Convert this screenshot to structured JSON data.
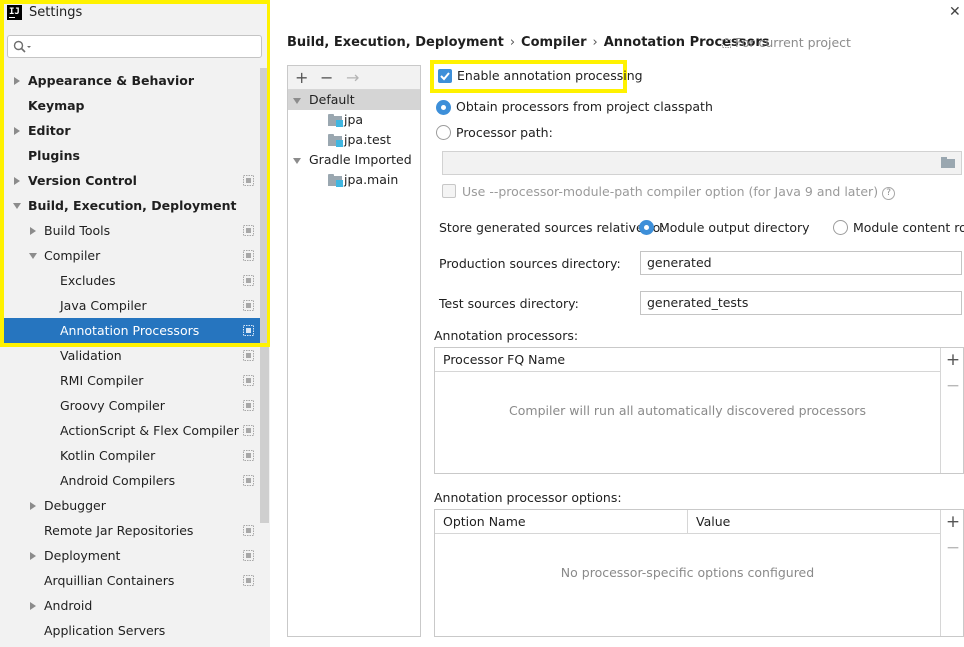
{
  "window": {
    "app_icon_text": "IJ",
    "title": "Settings",
    "close_glyph": "✕"
  },
  "search": {
    "placeholder": "",
    "icon": "search-icon"
  },
  "tree": [
    {
      "label": "Appearance & Behavior",
      "bold": true
    },
    {
      "label": "Keymap",
      "bold": true
    },
    {
      "label": "Editor",
      "bold": true
    },
    {
      "label": "Plugins",
      "bold": true
    },
    {
      "label": "Version Control",
      "bold": true
    },
    {
      "label": "Build, Execution, Deployment",
      "bold": true
    },
    {
      "label": "Build Tools"
    },
    {
      "label": "Compiler"
    },
    {
      "label": "Excludes"
    },
    {
      "label": "Java Compiler"
    },
    {
      "label": "Annotation Processors",
      "selected": true
    },
    {
      "label": "Validation"
    },
    {
      "label": "RMI Compiler"
    },
    {
      "label": "Groovy Compiler"
    },
    {
      "label": "ActionScript & Flex Compiler"
    },
    {
      "label": "Kotlin Compiler"
    },
    {
      "label": "Android Compilers"
    },
    {
      "label": "Debugger"
    },
    {
      "label": "Remote Jar Repositories"
    },
    {
      "label": "Deployment"
    },
    {
      "label": "Arquillian Containers"
    },
    {
      "label": "Android"
    },
    {
      "label": "Application Servers"
    }
  ],
  "breadcrumb": [
    "Build, Execution, Deployment",
    "Compiler",
    "Annotation Processors"
  ],
  "breadcrumb_sep": "›",
  "for_project": "For current project",
  "profiles": {
    "toolbar": {
      "add": "+",
      "remove": "−",
      "move": "→"
    },
    "items": [
      {
        "label": "Default",
        "type": "group",
        "selected": true
      },
      {
        "label": "jpa",
        "type": "module"
      },
      {
        "label": "jpa.test",
        "type": "module"
      },
      {
        "label": "Gradle Imported",
        "type": "group"
      },
      {
        "label": "jpa.main",
        "type": "module"
      }
    ]
  },
  "form": {
    "enable_label": "Enable annotation processing",
    "enable_checked": true,
    "obtain_label": "Obtain processors from project classpath",
    "path_label": "Processor path:",
    "path_value": "",
    "module_path_label": "Use --processor-module-path compiler option (for Java 9 and later)",
    "help_glyph": "?",
    "store_label": "Store generated sources relative to:",
    "store_module_output": "Module output directory",
    "store_module_content": "Module content root",
    "prod_label": "Production sources directory:",
    "prod_value": "generated",
    "test_label": "Test sources directory:",
    "test_value": "generated_tests"
  },
  "processors_table": {
    "caption": "Annotation processors:",
    "column": "Processor FQ Name",
    "empty": "Compiler will run all automatically discovered processors",
    "add": "+",
    "remove": "−"
  },
  "options_table": {
    "caption": "Annotation processor options:",
    "columns": [
      "Option Name",
      "Value"
    ],
    "empty": "No processor-specific options configured",
    "add": "+",
    "remove": "−"
  },
  "colors": {
    "accent": "#3d8fd9",
    "selection": "#2675bf",
    "highlight": "#fff200"
  }
}
